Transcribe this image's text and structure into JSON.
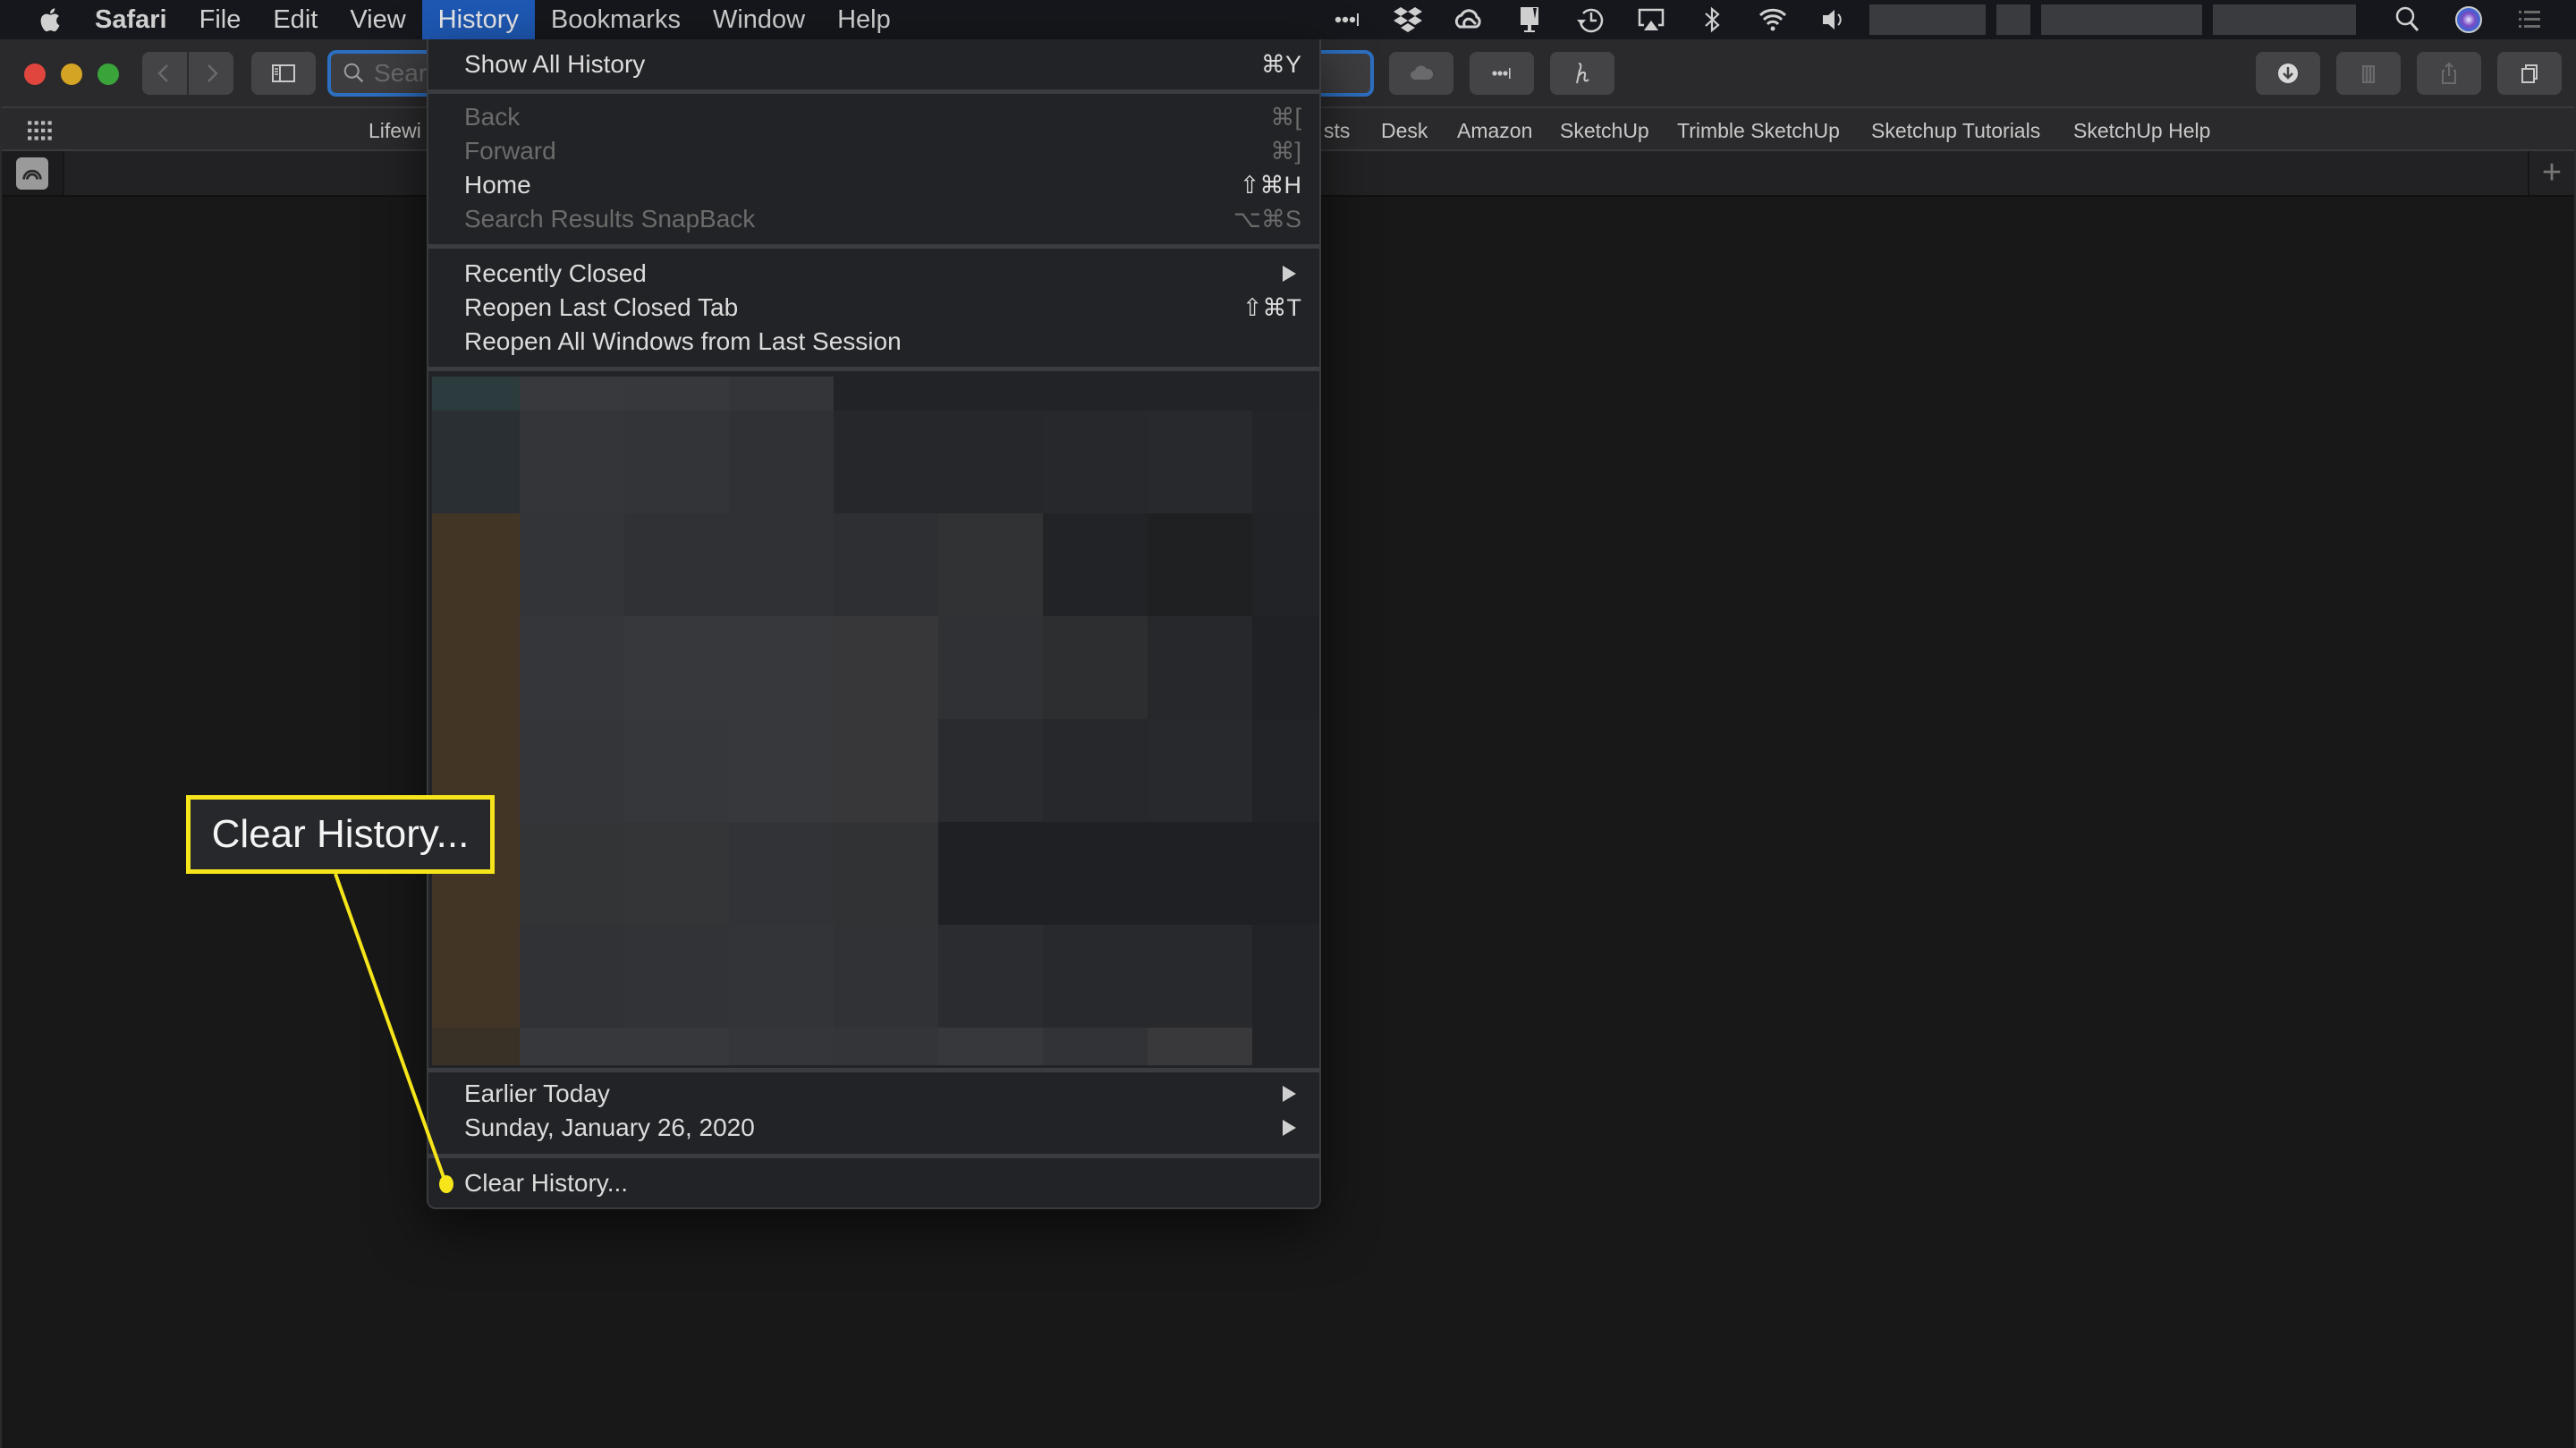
{
  "menubar": {
    "app_name": "Safari",
    "items": [
      "File",
      "Edit",
      "View",
      "History",
      "Bookmarks",
      "Window",
      "Help"
    ],
    "active_item": "History",
    "status_icons": [
      "more-dots-icon",
      "dropbox-icon",
      "creative-cloud-icon",
      "display-icon",
      "time-machine-icon",
      "airplay-icon",
      "bluetooth-icon",
      "wifi-icon",
      "volume-icon",
      "spotlight-search-icon",
      "siri-icon",
      "notification-center-icon"
    ]
  },
  "toolbar": {
    "search_placeholder": "Search",
    "buttons": [
      "back",
      "forward",
      "sidebar",
      "icloud-tabs",
      "password-extension",
      "honey-extension",
      "downloads",
      "reading-list",
      "share",
      "tab-overview"
    ]
  },
  "bookmarks": {
    "items": [
      "Lifewi",
      "sts",
      "Desk",
      "Amazon",
      "SketchUp",
      "Trimble SketchUp",
      "Sketchup Tutorials",
      "SketchUp Help"
    ]
  },
  "tabbar": {
    "new_tab_label": "+"
  },
  "history_menu": {
    "show_all": {
      "label": "Show All History",
      "shortcut": "⌘Y"
    },
    "nav_items": [
      {
        "label": "Back",
        "shortcut": "⌘[",
        "enabled": false
      },
      {
        "label": "Forward",
        "shortcut": "⌘]",
        "enabled": false
      },
      {
        "label": "Home",
        "shortcut": "⇧⌘H",
        "enabled": true
      },
      {
        "label": "Search Results SnapBack",
        "shortcut": "⌥⌘S",
        "enabled": false
      }
    ],
    "session_items": [
      {
        "label": "Recently Closed",
        "submenu": true
      },
      {
        "label": "Reopen Last Closed Tab",
        "shortcut": "⇧⌘T"
      },
      {
        "label": "Reopen All Windows from Last Session",
        "shortcut": ""
      }
    ],
    "day_items": [
      {
        "label": "Earlier Today",
        "submenu": true
      },
      {
        "label": "Sunday, January 26, 2020",
        "submenu": true
      }
    ],
    "clear_history": {
      "label": "Clear History..."
    }
  },
  "callout": {
    "text": "Clear History...",
    "color": "#f5e51a"
  },
  "colors": {
    "menu_highlight": "#1e58b3",
    "window_bg": "#181818",
    "menu_bg": "#222326",
    "search_focus": "#2c6ec0"
  }
}
